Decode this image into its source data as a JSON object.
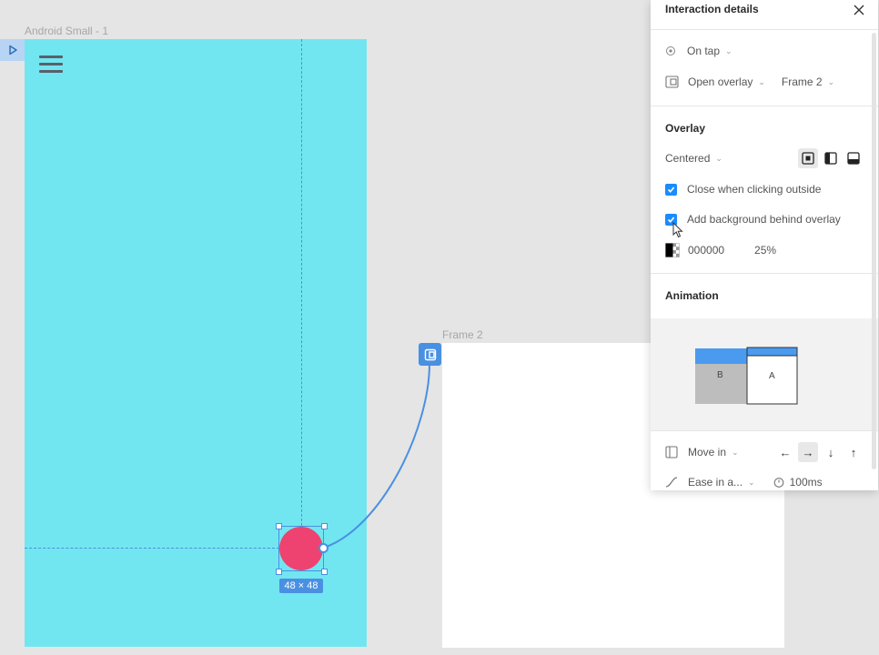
{
  "canvas": {
    "frame1_label": "Android Small - 1",
    "frame2_label": "Frame 2",
    "selection_size": "48 × 48"
  },
  "colors": {
    "canvas_bg": "#e5e5e5",
    "frame1_bg": "#72e6f0",
    "frame2_bg": "#ffffff",
    "fab": "#ee4370",
    "accent": "#4a90e2",
    "checkbox": "#1a8cff"
  },
  "panel": {
    "title": "Interaction details",
    "trigger": {
      "label": "On tap",
      "icon": "tap-icon"
    },
    "action": {
      "label": "Open overlay",
      "destination": "Frame 2",
      "icon": "overlay-icon"
    },
    "overlay": {
      "title": "Overlay",
      "position": "Centered",
      "position_options_icons": [
        "overlay-center-icon",
        "overlay-left-icon",
        "overlay-bottom-icon"
      ],
      "close_outside_label": "Close when clicking outside",
      "close_outside_checked": true,
      "add_bg_label": "Add background behind overlay",
      "add_bg_checked": true,
      "bg_color_hex": "000000",
      "bg_opacity": "25%"
    },
    "animation": {
      "title": "Animation",
      "preview_b": "B",
      "preview_a": "A",
      "type": "Move in",
      "direction_arrows": [
        "←",
        "→",
        "↓",
        "↑"
      ],
      "active_direction": "→",
      "easing": "Ease in a...",
      "duration": "100ms"
    }
  }
}
